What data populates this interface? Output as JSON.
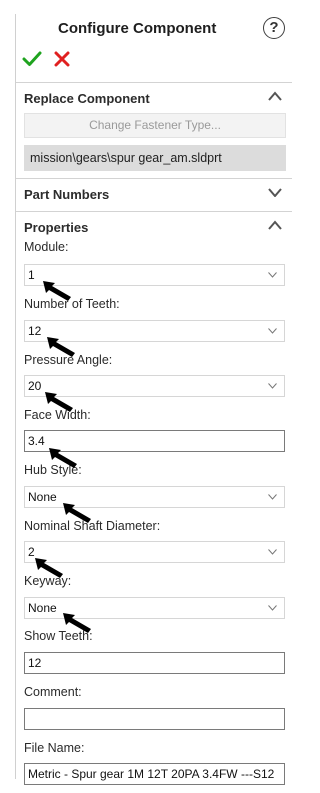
{
  "header": {
    "title": "Configure Component",
    "help_glyph": "?",
    "ok_icon": "checkmark-icon",
    "cancel_icon": "x-icon",
    "ok_color": "#1fa31f",
    "cancel_color": "#e02020"
  },
  "replace_section": {
    "title": "Replace Component",
    "button_label": "Change Fastener Type...",
    "path": "mission\\gears\\spur gear_am.sldprt",
    "expanded": true
  },
  "part_numbers_section": {
    "title": "Part Numbers",
    "expanded": false
  },
  "properties_section": {
    "title": "Properties",
    "expanded": true,
    "fields": [
      {
        "label": "Module:",
        "value": "1",
        "type": "dropdown"
      },
      {
        "label": "Number of Teeth:",
        "value": "12",
        "type": "dropdown"
      },
      {
        "label": "Pressure Angle:",
        "value": "20",
        "type": "dropdown"
      },
      {
        "label": "Face Width:",
        "value": "3.4",
        "type": "text"
      },
      {
        "label": "Hub Style:",
        "value": "None",
        "type": "dropdown"
      },
      {
        "label": "Nominal Shaft Diameter:",
        "value": "2",
        "type": "dropdown"
      },
      {
        "label": "Keyway:",
        "value": "None",
        "type": "dropdown"
      },
      {
        "label": "Show Teeth:",
        "value": "12",
        "type": "text"
      },
      {
        "label": "Comment:",
        "value": "",
        "type": "text"
      },
      {
        "label": "File Name:",
        "value": "Metric - Spur gear 1M 12T 20PA 3.4FW ---S12",
        "type": "text"
      }
    ]
  }
}
